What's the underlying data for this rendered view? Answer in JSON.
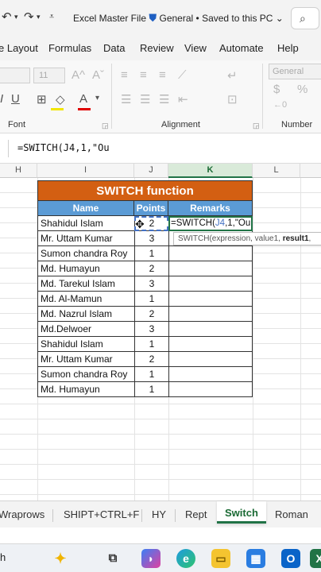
{
  "titlebar": {
    "title": "Excel Master File",
    "sensitivity": "General",
    "save_status": "• Saved to this PC",
    "shield_icon": "shield-icon",
    "accent": "#1e5fc2"
  },
  "menu": {
    "tabs": [
      "e Layout",
      "Formulas",
      "Data",
      "Review",
      "View",
      "Automate",
      "Help"
    ]
  },
  "ribbon": {
    "font_size_value": "11",
    "number_format_value": "General",
    "groups": [
      "Font",
      "Alignment",
      "Number"
    ]
  },
  "formula_bar": {
    "content": "=SWITCH(J4,1,\"Ou"
  },
  "columns": [
    "H",
    "I",
    "J",
    "K",
    "L"
  ],
  "table": {
    "title": "SWITCH function",
    "title_color": "#d35f12",
    "header_color": "#5b9bd5",
    "headers": [
      "Name",
      "Points",
      "Remarks"
    ],
    "rows": [
      {
        "name": "Shahidul Islam",
        "points": "2"
      },
      {
        "name": "Mr. Uttam Kumar",
        "points": "3"
      },
      {
        "name": "Sumon chandra Roy",
        "points": "1"
      },
      {
        "name": "Md. Humayun",
        "points": "2"
      },
      {
        "name": "Md. Tarekul Islam",
        "points": "3"
      },
      {
        "name": "Md. Al-Mamun",
        "points": "1"
      },
      {
        "name": "Md. Nazrul Islam",
        "points": "2"
      },
      {
        "name": "Md.Delwoer",
        "points": "3"
      },
      {
        "name": "Shahidul Islam",
        "points": "1"
      },
      {
        "name": "Mr. Uttam Kumar",
        "points": "2"
      },
      {
        "name": "Sumon chandra Roy",
        "points": "1"
      },
      {
        "name": "Md. Humayun",
        "points": "1"
      }
    ],
    "editing_cell": {
      "prefix": "=SWITCH(",
      "ref": "J4",
      "suffix": ",1,\"Ou"
    },
    "tooltip": {
      "signature": "SWITCH(expression, value1, ",
      "bold_part": "result1",
      "tail": ","
    }
  },
  "sheet_tabs": {
    "tabs": [
      "Wraprows",
      "SHIPT+CTRL+F",
      "HY",
      "Rept",
      "Switch",
      "Roman"
    ],
    "active": "Switch",
    "accent": "#217346"
  },
  "taskbar": {
    "search_fragment": "h"
  }
}
